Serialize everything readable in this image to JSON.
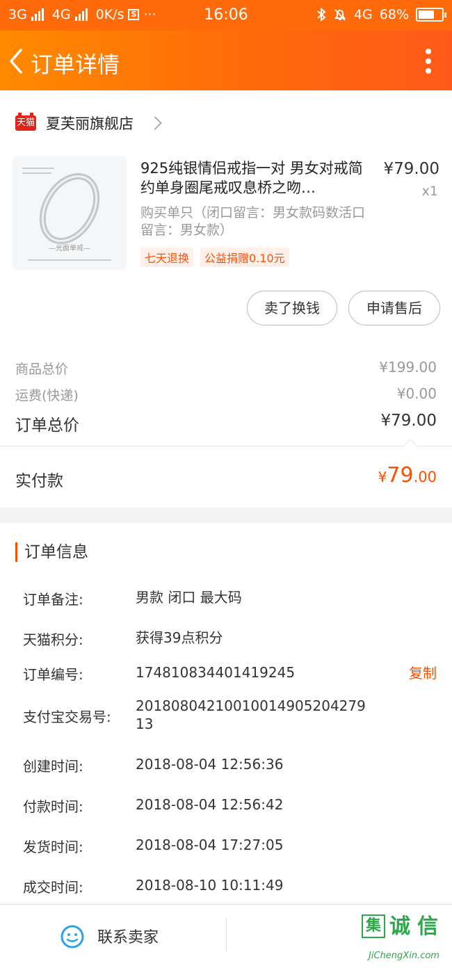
{
  "status_bar": {
    "network1": "3G",
    "network2": "4G",
    "speed": "0K/s",
    "s_icon": "S",
    "dots": "···",
    "time": "16:06",
    "net_right": "4G",
    "battery": "68%",
    "battery_level": 0.68
  },
  "header": {
    "title": "订单详情"
  },
  "shop": {
    "badge": "天猫",
    "name": "夏芙丽旗舰店"
  },
  "product": {
    "title": "925纯银情侣戒指一对 男女对戒简约单身圈尾戒叹息桥之吻…",
    "price": "¥79.00",
    "qty": "x1",
    "spec": "购买单只（闭口留言：男女款码数活口留言：男女款）",
    "tags": [
      "七天退换",
      "公益捐赠0.10元"
    ],
    "image_caption": "—光面单戒—"
  },
  "actions": {
    "sell": "卖了换钱",
    "after_sale": "申请售后"
  },
  "summary": {
    "goods_label": "商品总价",
    "goods_value": "¥199.00",
    "shipping_label": "运费(快递)",
    "shipping_value": "¥0.00",
    "total_label": "订单总价",
    "total_value": "¥79.00",
    "paid_label": "实付款",
    "paid_currency": "¥",
    "paid_int": "79",
    "paid_dec": ".00"
  },
  "order_info": {
    "title": "订单信息",
    "copy_label": "复制",
    "rows": [
      {
        "key": "订单备注:",
        "value": "男款 闭口 最大码"
      },
      {
        "key": "天猫积分:",
        "value": "获得39点积分"
      },
      {
        "key": "订单编号:",
        "value": "174810834401419245"
      },
      {
        "key": "支付宝交易号:",
        "value": "2018080421001001490520427913"
      },
      {
        "key": "创建时间:",
        "value": "2018-08-04 12:56:36"
      },
      {
        "key": "付款时间:",
        "value": "2018-08-04 12:56:42"
      },
      {
        "key": "发货时间:",
        "value": "2018-08-04 17:27:05"
      },
      {
        "key": "成交时间:",
        "value": "2018-08-10 10:11:49"
      }
    ]
  },
  "bottom": {
    "contact_label": "联系卖家",
    "watermark_box": "集",
    "watermark_chars": [
      "诚",
      "信"
    ],
    "watermark_url": "JiChengXin.com"
  },
  "colors": {
    "accent": "#ff5000",
    "header": "#ff6a0a",
    "watermark": "#2ba84a"
  }
}
